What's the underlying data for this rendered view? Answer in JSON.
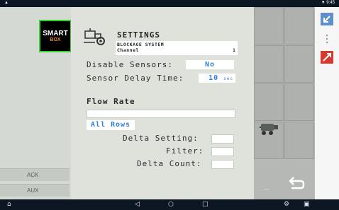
{
  "statusbar": {
    "left": "▲",
    "right": "▼ 9:45"
  },
  "logo": {
    "line1": "SMART",
    "line2": "BOX"
  },
  "sidebar": {
    "ack": "ACK",
    "aux": "AUX"
  },
  "settings": {
    "title": "SETTINGS",
    "subtitle1": "BLOCKAGE SYSTEM",
    "subtitle2": "Channel",
    "channel_number": "1",
    "disable_sensors_label": "Disable Sensors:",
    "disable_sensors_value": "No",
    "sensor_delay_label": "Sensor Delay Time:",
    "sensor_delay_value": "10",
    "sensor_delay_unit": "sec",
    "flow_rate_label": "Flow Rate",
    "all_rows": "All Rows",
    "delta_setting_label": "Delta Setting:",
    "filter_label": "Filter:",
    "delta_count_label": "Delta Count:"
  },
  "grid": {
    "more": "..."
  },
  "navbar": {
    "home": "⌂",
    "back": "◁",
    "circle": "○",
    "recent": "□"
  },
  "colors": {
    "accent_blue": "#2f7fd8",
    "logo_border": "#35d42c",
    "status_bar": "#0d1623"
  },
  "icons": [
    "gear-icon",
    "sprayer-icon",
    "back-arrow-icon",
    "arrow-icon",
    "vertical-dots-icon",
    "swap-icon"
  ]
}
